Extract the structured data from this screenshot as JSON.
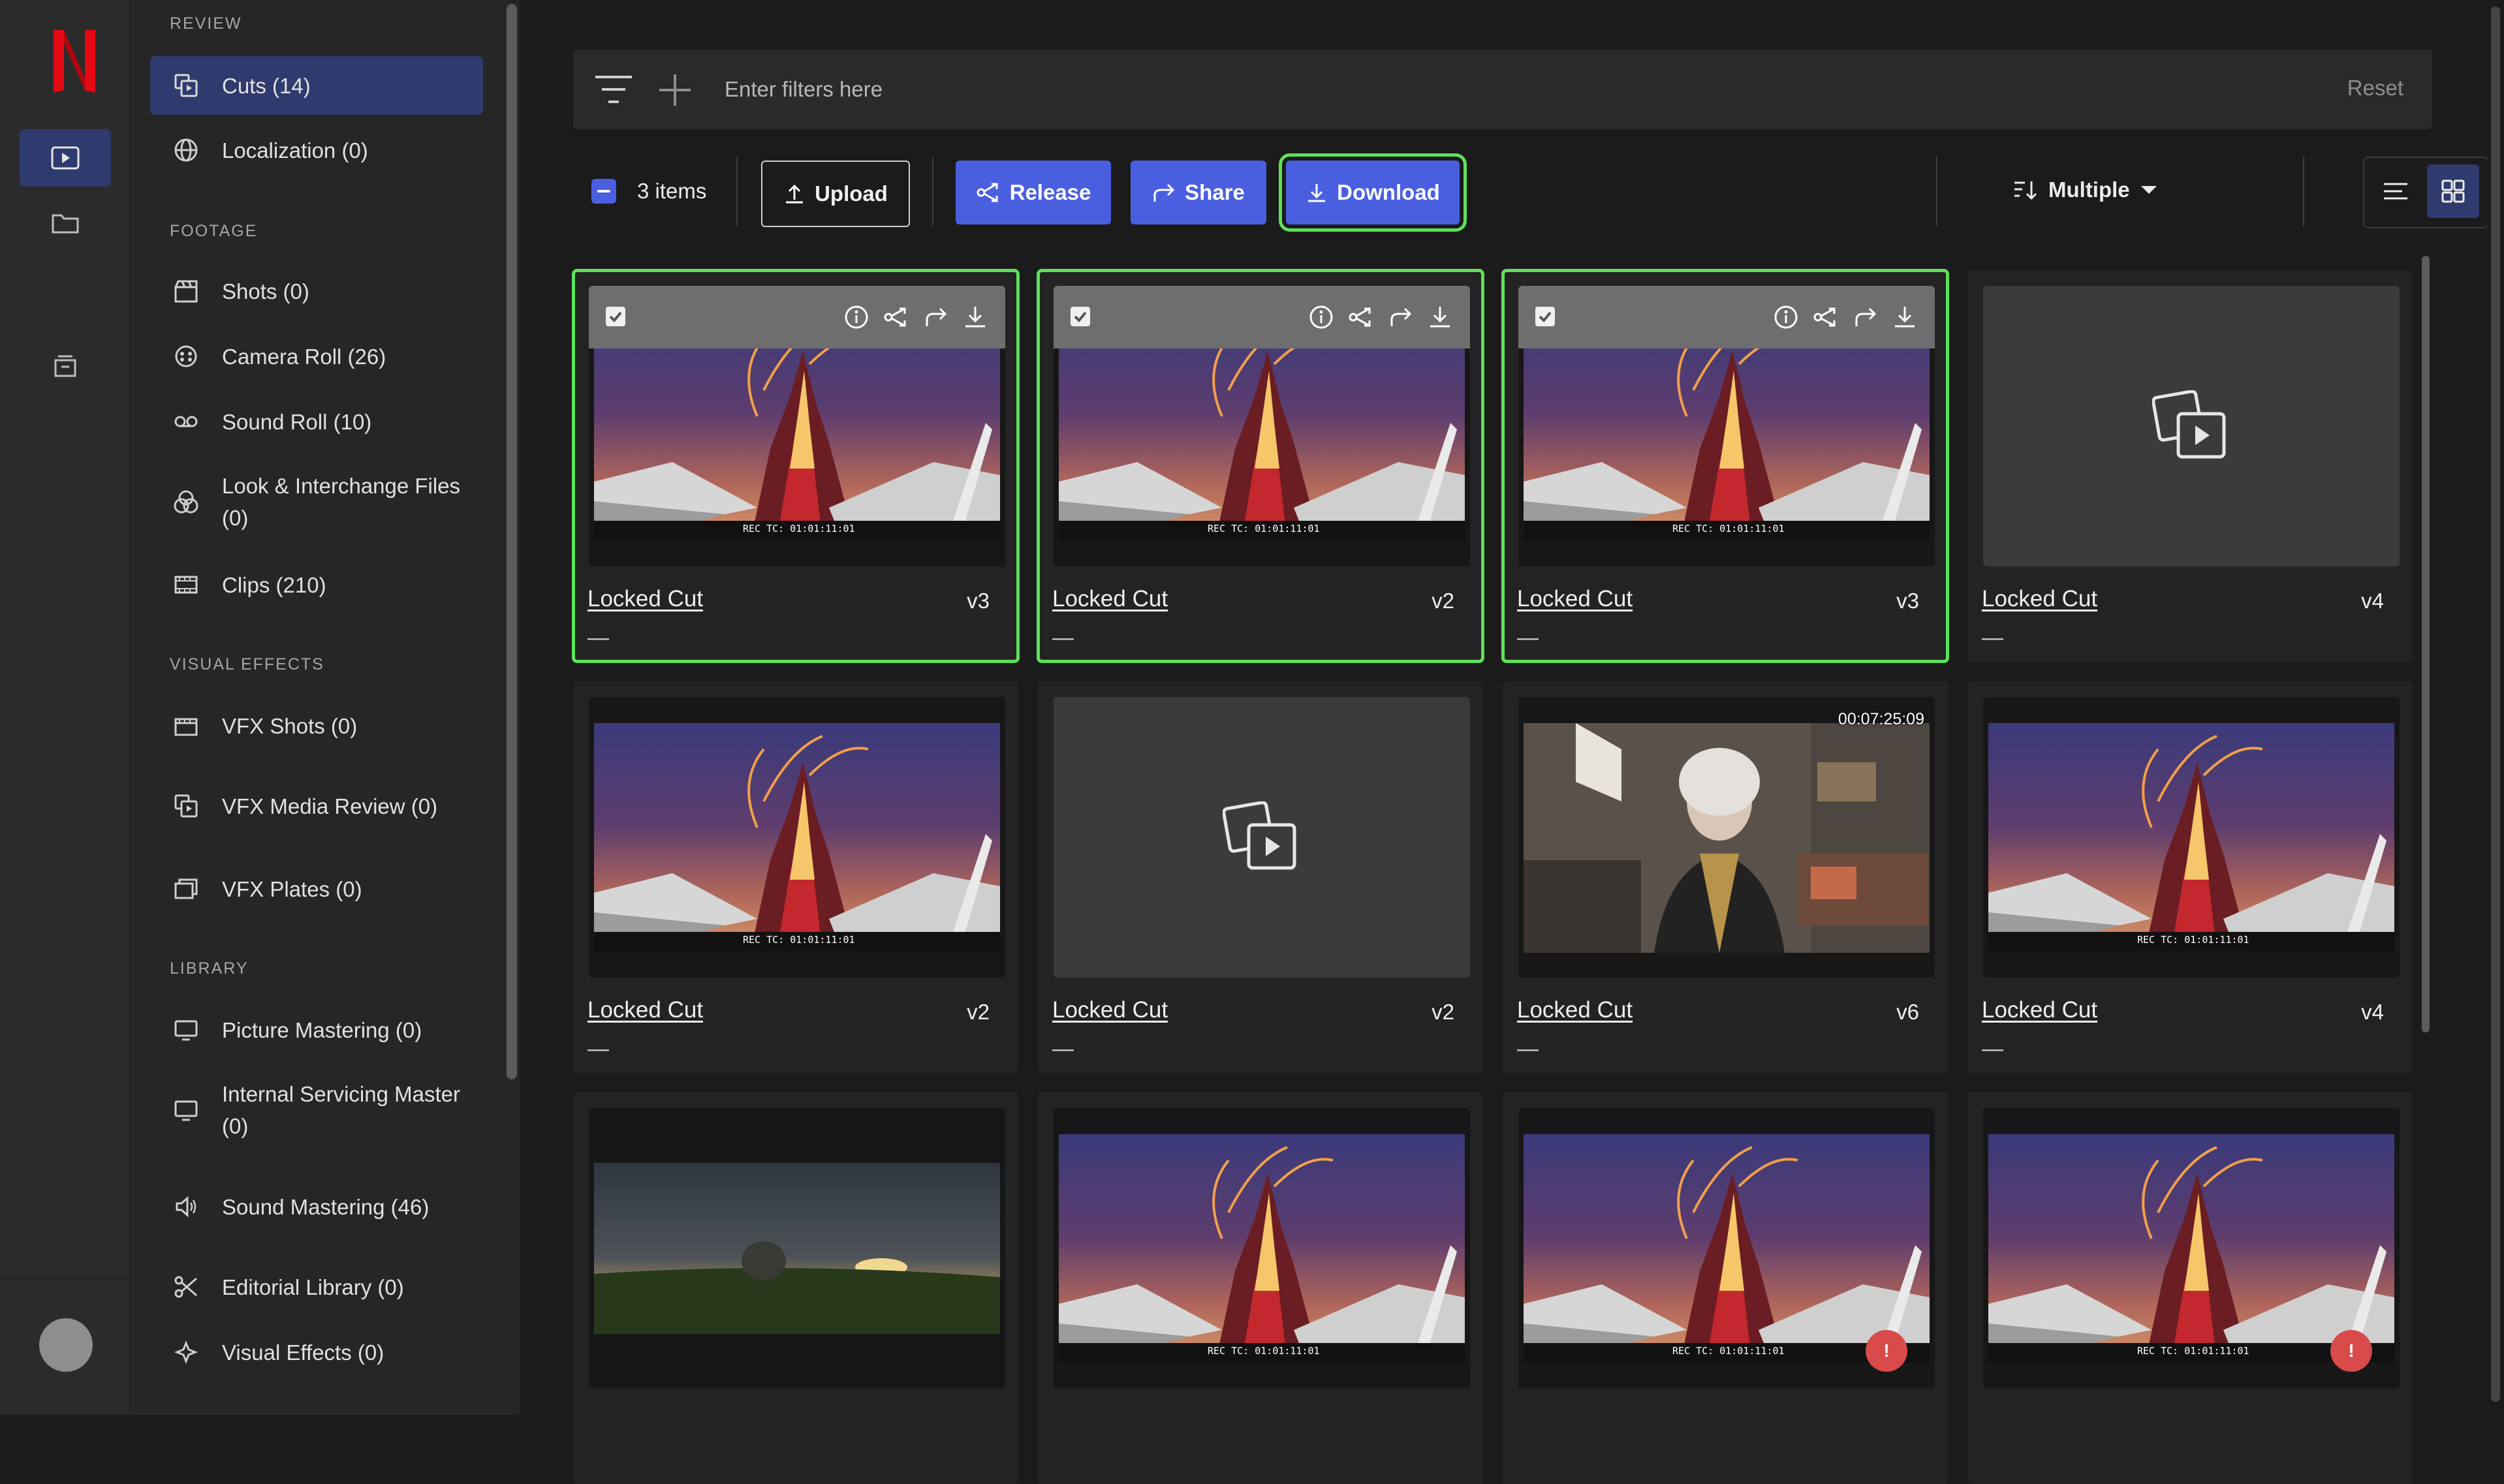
{
  "rail": {
    "logo_letter": "N",
    "brand_color": "#e50914"
  },
  "sidebar": {
    "sections": [
      {
        "title": "REVIEW",
        "items": [
          {
            "label": "Cuts (14)",
            "icon": "cuts-icon",
            "active": true
          },
          {
            "label": "Localization (0)",
            "icon": "globe-icon"
          }
        ]
      },
      {
        "title": "FOOTAGE",
        "items": [
          {
            "label": "Shots (0)",
            "icon": "clapper-icon"
          },
          {
            "label": "Camera Roll (26)",
            "icon": "camera-roll-icon"
          },
          {
            "label": "Sound Roll (10)",
            "icon": "tape-icon"
          },
          {
            "label": "Look & Interchange Files (0)",
            "icon": "look-icon"
          },
          {
            "label": "Clips (210)",
            "icon": "film-icon"
          }
        ]
      },
      {
        "title": "VISUAL EFFECTS",
        "items": [
          {
            "label": "VFX Shots (0)",
            "icon": "vfx-shots-icon"
          },
          {
            "label": "VFX Media Review (0)",
            "icon": "cuts-icon"
          },
          {
            "label": "VFX Plates (0)",
            "icon": "plates-icon"
          }
        ]
      },
      {
        "title": "LIBRARY",
        "items": [
          {
            "label": "Picture Mastering (0)",
            "icon": "monitor-icon"
          },
          {
            "label": "Internal Servicing Master (0)",
            "icon": "monitor-icon"
          },
          {
            "label": "Sound Mastering (46)",
            "icon": "speaker-icon"
          },
          {
            "label": "Editorial Library (0)",
            "icon": "scissors-icon"
          },
          {
            "label": "Visual Effects (0)",
            "icon": "vfx-icon"
          }
        ]
      }
    ]
  },
  "filter": {
    "placeholder": "Enter filters here",
    "reset_label": "Reset"
  },
  "toolbar": {
    "count_label": "3 items",
    "upload_label": "Upload",
    "release_label": "Release",
    "share_label": "Share",
    "download_label": "Download",
    "sort_label": "Multiple",
    "accent_color": "#4a5fe0",
    "focus_color": "#5ee05a"
  },
  "cards": [
    {
      "title": "Locked Cut",
      "version": "v3",
      "meta": "—",
      "thumb": "fire",
      "selected": true
    },
    {
      "title": "Locked Cut",
      "version": "v2",
      "meta": "—",
      "thumb": "fire",
      "selected": true
    },
    {
      "title": "Locked Cut",
      "version": "v3",
      "meta": "—",
      "thumb": "fire",
      "selected": true
    },
    {
      "title": "Locked Cut",
      "version": "v4",
      "meta": "—",
      "thumb": "placeholder",
      "selected": false
    },
    {
      "title": "Locked Cut",
      "version": "v2",
      "meta": "—",
      "thumb": "fire",
      "selected": false
    },
    {
      "title": "Locked Cut",
      "version": "v2",
      "meta": "—",
      "thumb": "placeholder",
      "selected": false
    },
    {
      "title": "Locked Cut",
      "version": "v6",
      "meta": "—",
      "thumb": "interview",
      "timecode": "00:07:25:09",
      "selected": false
    },
    {
      "title": "Locked Cut",
      "version": "v4",
      "meta": "—",
      "thumb": "fire",
      "selected": false
    },
    {
      "title": "",
      "version": "",
      "meta": "",
      "thumb": "landscape",
      "selected": false
    },
    {
      "title": "",
      "version": "",
      "meta": "",
      "thumb": "fire",
      "selected": false
    },
    {
      "title": "",
      "version": "",
      "meta": "",
      "thumb": "fire",
      "alert": true,
      "selected": false
    },
    {
      "title": "",
      "version": "",
      "meta": "",
      "thumb": "fire",
      "alert": true,
      "selected": false
    }
  ]
}
